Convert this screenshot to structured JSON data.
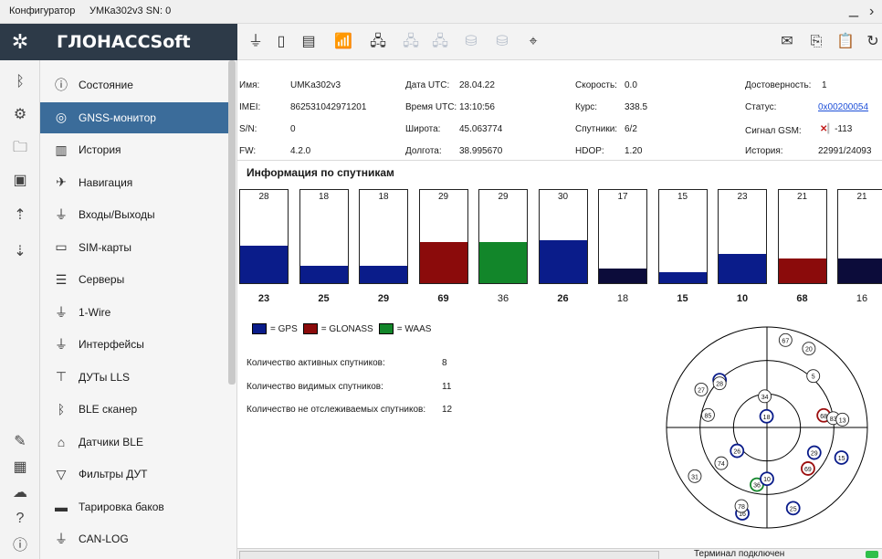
{
  "window": {
    "app_title": "Конфигуратор",
    "device": "УМКа302v3 SN: 0"
  },
  "brand": "ГЛОНАССSoft",
  "nav": [
    {
      "label": "Состояние",
      "icon": "info-icon"
    },
    {
      "label": "GNSS-монитор",
      "icon": "satellite-icon"
    },
    {
      "label": "История",
      "icon": "book-icon"
    },
    {
      "label": "Навигация",
      "icon": "navigation-icon"
    },
    {
      "label": "Входы/Выходы",
      "icon": "io-icon"
    },
    {
      "label": "SIM-карты",
      "icon": "sim-icon"
    },
    {
      "label": "Серверы",
      "icon": "server-icon"
    },
    {
      "label": "1-Wire",
      "icon": "plug-icon"
    },
    {
      "label": "Интерфейсы",
      "icon": "plug-icon"
    },
    {
      "label": "ДУТы LLS",
      "icon": "sensor-icon"
    },
    {
      "label": "BLE сканер",
      "icon": "bluetooth-icon"
    },
    {
      "label": "Датчики BLE",
      "icon": "ble-sensor-icon"
    },
    {
      "label": "Фильтры ДУТ",
      "icon": "filter-icon"
    },
    {
      "label": "Тарировка баков",
      "icon": "tank-icon"
    },
    {
      "label": "CAN-LOG",
      "icon": "plug-icon"
    }
  ],
  "info": {
    "name_label": "Имя:",
    "name": "UMKa302v3",
    "imei_label": "IMEI:",
    "imei": "862531042971201",
    "sn_label": "S/N:",
    "sn": "0",
    "fw_label": "FW:",
    "fw": "4.2.0",
    "date_label": "Дата UTC:",
    "date": "28.04.22",
    "time_label": "Время UTC:",
    "time": "13:10:56",
    "lat_label": "Широта:",
    "lat": "45.063774",
    "lon_label": "Долгота:",
    "lon": "38.995670",
    "speed_label": "Скорость:",
    "speed": "0.0",
    "course_label": "Курс:",
    "course": "338.5",
    "sats_label": "Спутники:",
    "sats": "6/2",
    "hdop_label": "HDOP:",
    "hdop": "1.20",
    "valid_label": "Достоверность:",
    "valid": "1",
    "status_label": "Статус:",
    "status": "0x00200054",
    "gsm_label": "Сигнал GSM:",
    "gsm": "-113",
    "history_label": "История:",
    "history": "22991/24093"
  },
  "section_title": "Информация по спутникам",
  "colors": {
    "GPS": "#0a1c8a",
    "GLONASS": "#8b0b0b",
    "WAAS": "#12862a",
    "untracked": "#0c0c3a",
    "brand_bg": "#2d3a48",
    "active_nav": "#3b6c9a"
  },
  "satellites": [
    {
      "cn": "28",
      "prn": "23",
      "system": "GPS",
      "fill": 0.4,
      "bold": true
    },
    {
      "cn": "18",
      "prn": "25",
      "system": "GPS",
      "fill": 0.19,
      "bold": true
    },
    {
      "cn": "18",
      "prn": "29",
      "system": "GPS",
      "fill": 0.19,
      "bold": true
    },
    {
      "cn": "29",
      "prn": "69",
      "system": "GLONASS",
      "fill": 0.44,
      "bold": true
    },
    {
      "cn": "29",
      "prn": "36",
      "system": "WAAS",
      "fill": 0.44,
      "bold": false
    },
    {
      "cn": "30",
      "prn": "26",
      "system": "GPS",
      "fill": 0.46,
      "bold": true
    },
    {
      "cn": "17",
      "prn": "18",
      "system": "untracked",
      "fill": 0.16,
      "bold": false
    },
    {
      "cn": "15",
      "prn": "15",
      "system": "GPS",
      "fill": 0.12,
      "bold": true
    },
    {
      "cn": "23",
      "prn": "10",
      "system": "GPS",
      "fill": 0.31,
      "bold": true
    },
    {
      "cn": "21",
      "prn": "68",
      "system": "GLONASS",
      "fill": 0.26,
      "bold": true
    },
    {
      "cn": "21",
      "prn": "16",
      "system": "untracked",
      "fill": 0.26,
      "bold": false
    }
  ],
  "legend": [
    {
      "label": "= GPS",
      "system": "GPS"
    },
    {
      "label": "= GLONASS",
      "system": "GLONASS"
    },
    {
      "label": "= WAAS",
      "system": "WAAS"
    }
  ],
  "stats": [
    {
      "label": "Количество активных спутников:",
      "value": "8"
    },
    {
      "label": "Количество видимых спутников:",
      "value": "11"
    },
    {
      "label": "Количество не отслеживаемых спутников:",
      "value": "12"
    }
  ],
  "skyplot": [
    {
      "prn": "67",
      "az": 12,
      "el": 10,
      "system": "none"
    },
    {
      "prn": "20",
      "az": 28,
      "el": 10,
      "system": "none"
    },
    {
      "prn": "5",
      "az": 42,
      "el": 28,
      "system": "none"
    },
    {
      "prn": "27",
      "az": 300,
      "el": 22,
      "system": "none"
    },
    {
      "prn": "23",
      "az": 315,
      "el": 30,
      "system": "GPS"
    },
    {
      "prn": "28",
      "az": 313,
      "el": 32,
      "system": "none"
    },
    {
      "prn": "34",
      "az": 356,
      "el": 62,
      "system": "none"
    },
    {
      "prn": "68",
      "az": 78,
      "el": 38,
      "system": "GLONASS"
    },
    {
      "prn": "83",
      "az": 82,
      "el": 30,
      "system": "none"
    },
    {
      "prn": "13",
      "az": 84,
      "el": 22,
      "system": "none"
    },
    {
      "prn": "18",
      "az": 358,
      "el": 80,
      "system": "GPS"
    },
    {
      "prn": "85",
      "az": 282,
      "el": 36,
      "system": "none"
    },
    {
      "prn": "26",
      "az": 232,
      "el": 56,
      "system": "GPS"
    },
    {
      "prn": "29",
      "az": 118,
      "el": 42,
      "system": "GPS"
    },
    {
      "prn": "15",
      "az": 112,
      "el": 18,
      "system": "GPS"
    },
    {
      "prn": "74",
      "az": 232,
      "el": 38,
      "system": "none"
    },
    {
      "prn": "69",
      "az": 135,
      "el": 38,
      "system": "GLONASS"
    },
    {
      "prn": "31",
      "az": 236,
      "el": 12,
      "system": "none"
    },
    {
      "prn": "36",
      "az": 190,
      "el": 38,
      "system": "WAAS"
    },
    {
      "prn": "10",
      "az": 180,
      "el": 44,
      "system": "GPS"
    },
    {
      "prn": "16",
      "az": 196,
      "el": 10,
      "system": "untracked"
    },
    {
      "prn": "78",
      "az": 198,
      "el": 16,
      "system": "none"
    },
    {
      "prn": "25",
      "az": 162,
      "el": 14,
      "system": "GPS"
    }
  ],
  "statusbar": {
    "text": "Терминал подключен"
  }
}
